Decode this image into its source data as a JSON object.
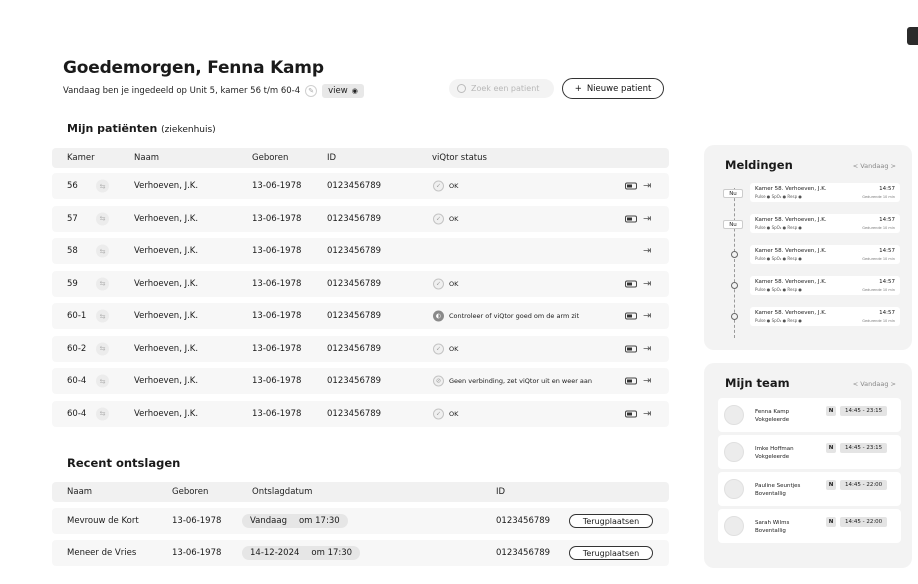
{
  "header": {
    "greeting": "Goedemorgen, Fenna Kamp",
    "assignment": "Vandaag ben je ingedeeld op Unit 5, kamer 56 t/m 60-4",
    "view_label": "view",
    "search_placeholder": "Zoek een patient",
    "new_patient_label": "Nieuwe patient"
  },
  "patients": {
    "title": "Mijn patiënten",
    "subtitle": "(ziekenhuis)",
    "columns": {
      "room": "Kamer",
      "name": "Naam",
      "born": "Geboren",
      "id": "ID",
      "status": "viQtor status"
    },
    "rows": [
      {
        "room": "56",
        "name": "Verhoeven, J.K.",
        "born": "13-06-1978",
        "id": "0123456789",
        "status": "OK",
        "status_icon": "check-icon",
        "battery": true
      },
      {
        "room": "57",
        "name": "Verhoeven, J.K.",
        "born": "13-06-1978",
        "id": "0123456789",
        "status": "OK",
        "status_icon": "check-icon",
        "battery": true
      },
      {
        "room": "58",
        "name": "Verhoeven, J.K.",
        "born": "13-06-1978",
        "id": "0123456789",
        "status": "",
        "status_icon": "",
        "battery": false
      },
      {
        "room": "59",
        "name": "Verhoeven, J.K.",
        "born": "13-06-1978",
        "id": "0123456789",
        "status": "OK",
        "status_icon": "check-icon",
        "battery": true
      },
      {
        "room": "60-1",
        "name": "Verhoeven, J.K.",
        "born": "13-06-1978",
        "id": "0123456789",
        "status": "Controleer of viQtor goed om de arm zit",
        "status_icon": "arm-icon",
        "battery": true
      },
      {
        "room": "60-2",
        "name": "Verhoeven, J.K.",
        "born": "13-06-1978",
        "id": "0123456789",
        "status": "OK",
        "status_icon": "check-icon",
        "battery": true
      },
      {
        "room": "60-4",
        "name": "Verhoeven, J.K.",
        "born": "13-06-1978",
        "id": "0123456789",
        "status": "Geen verbinding, zet viQtor uit en weer aan",
        "status_icon": "no-connection-icon",
        "battery": true
      },
      {
        "room": "60-4",
        "name": "Verhoeven, J.K.",
        "born": "13-06-1978",
        "id": "0123456789",
        "status": "OK",
        "status_icon": "check-icon",
        "battery": true
      }
    ]
  },
  "discharged": {
    "title": "Recent ontslagen",
    "columns": {
      "name": "Naam",
      "born": "Geboren",
      "date": "Ontslagdatum",
      "id": "ID"
    },
    "rows": [
      {
        "name": "Mevrouw de Kort",
        "born": "13-06-1978",
        "date": "Vandaag",
        "time": "om 17:30",
        "id": "0123456789",
        "action": "Terugplaatsen"
      },
      {
        "name": "Meneer de Vries",
        "born": "13-06-1978",
        "date": "14-12-2024",
        "time": "om 17:30",
        "id": "0123456789",
        "action": "Terugplaatsen"
      }
    ]
  },
  "notifications": {
    "title": "Meldingen",
    "nav": "< Vandaag >",
    "now_label": "Nu",
    "items": [
      {
        "title": "Kamer 58. Verhoeven, J.K.",
        "time": "14:57",
        "vitals": "Pulse ●   SpO₂ ●   Resp ●",
        "freq": "Gedurende 10 min"
      },
      {
        "title": "Kamer 58. Verhoeven, J.K.",
        "time": "14:57",
        "vitals": "Pulse ●   SpO₂ ●   Resp ●",
        "freq": "Gedurende 10 min"
      },
      {
        "title": "Kamer 58. Verhoeven, J.K.",
        "time": "14:57",
        "vitals": "Pulse ●   SpO₂ ●   Resp ●",
        "freq": "Gedurende 10 min"
      },
      {
        "title": "Kamer 58. Verhoeven, J.K.",
        "time": "14:57",
        "vitals": "Pulse ●   SpO₂ ●   Resp ●",
        "freq": "Gedurende 10 min"
      },
      {
        "title": "Kamer 58. Verhoeven, J.K.",
        "time": "14:57",
        "vitals": "Pulse ●   SpO₂ ●   Resp ●",
        "freq": "Gedurende 10 min"
      }
    ]
  },
  "team": {
    "title": "Mijn team",
    "nav": "< Vandaag >",
    "members": [
      {
        "name": "Fenna Kamp",
        "role": "Vokgeleerde",
        "shift": "N",
        "time": "14:45 - 23:15"
      },
      {
        "name": "Imke Hoffman",
        "role": "Vokgeleerde",
        "shift": "N",
        "time": "14:45 - 23:15"
      },
      {
        "name": "Pauline Seuntjes",
        "role": "Boventallig",
        "shift": "N",
        "time": "14:45 - 22:00"
      },
      {
        "name": "Sarah Wilms",
        "role": "Boventallig",
        "shift": "N",
        "time": "14:45 - 22:00"
      }
    ]
  }
}
